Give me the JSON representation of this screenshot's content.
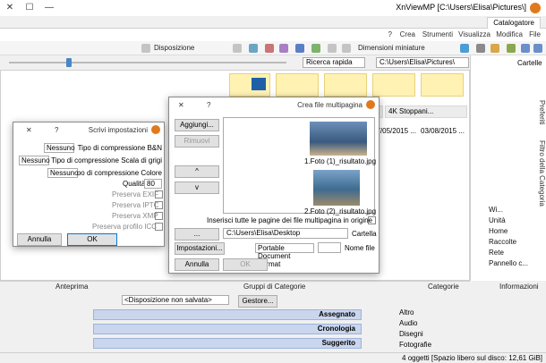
{
  "window": {
    "title": "XnViewMP [C:\\Users\\Elisa\\Pictures\\]",
    "tab_label": "Catalogatore",
    "min": "—",
    "max": "☐",
    "close": "✕"
  },
  "menu": [
    "File",
    "Modifica",
    "Visualizza",
    "Strumenti",
    "Crea",
    "?"
  ],
  "toolbar": {
    "view_mode": "Dimensioni miniature",
    "layout": "Disposizione",
    "filter_placeholder": "Ricerca rapida",
    "path": "C:\\Users\\Elisa\\Pictures\\"
  },
  "filelist": {
    "col1": "4K Stoppani...",
    "col2": "...",
    "date1": "03/08/2015 ...",
    "date2": "27/05/2015 ..."
  },
  "folders": {
    "title": "Cartelle",
    "side_tabs": [
      "Preferiti",
      "Filtro della Categoria"
    ],
    "items": [
      "Wi...",
      "Unità",
      "Home",
      "Raccolte",
      "Rete",
      "Pannello c..."
    ]
  },
  "bottom": {
    "info_title": "Informazioni",
    "categories_title": "Categorie",
    "category_sets_title": "Gruppi di Categorie",
    "preview_title": "Anteprima",
    "category_set_select": "<Disposizione non salvata>",
    "manage_btn": "Gestore...",
    "categories": [
      "Altro",
      "Audio",
      "Disegni",
      "Fotografie"
    ],
    "sets": [
      "Assegnato",
      "Cronologia",
      "Suggerito"
    ]
  },
  "status": "4 oggetti [Spazio libero sul disco: 12,61 GiB]",
  "dlg_multipage": {
    "title": "Crea file multipagina",
    "help": "?",
    "close": "✕",
    "add_btn": "Aggiungi...",
    "remove_btn": "Rimuovi",
    "up_btn": "^",
    "down_btn": "v",
    "file1": "1.Foto (1)_risultato.jpg",
    "file2": "2.Foto (2)_risultato.jpg",
    "insert_all": "Inserisci tutte le pagine dei file multipagina in origine",
    "folder_label": "Cartella",
    "folder_value": "C:\\Users\\Elisa\\Desktop",
    "browse_btn": "...",
    "name_label": "Nome file",
    "format_value": "Portable Document Format",
    "settings_btn": "Impostazioni...",
    "ok_btn": "OK",
    "cancel_btn": "Annulla"
  },
  "dlg_write": {
    "title": "Scrivi impostazioni",
    "help": "?",
    "close": "✕",
    "bw_label": "Tipo di compressione B&N",
    "bw_value": "Nessuno",
    "gray_label": "Tipo di compressione Scala di grigi",
    "gray_value": "Nessuno",
    "color_label": "Tipo di compressione Colore",
    "color_value": "Nessuno",
    "quality_label": "Qualità",
    "quality_value": "80",
    "opts": [
      "Preserva EXIF",
      "Preserva IPTC",
      "Preserva XMP",
      "Preserva profilo ICC"
    ],
    "ok_btn": "OK",
    "cancel_btn": "Annulla"
  }
}
